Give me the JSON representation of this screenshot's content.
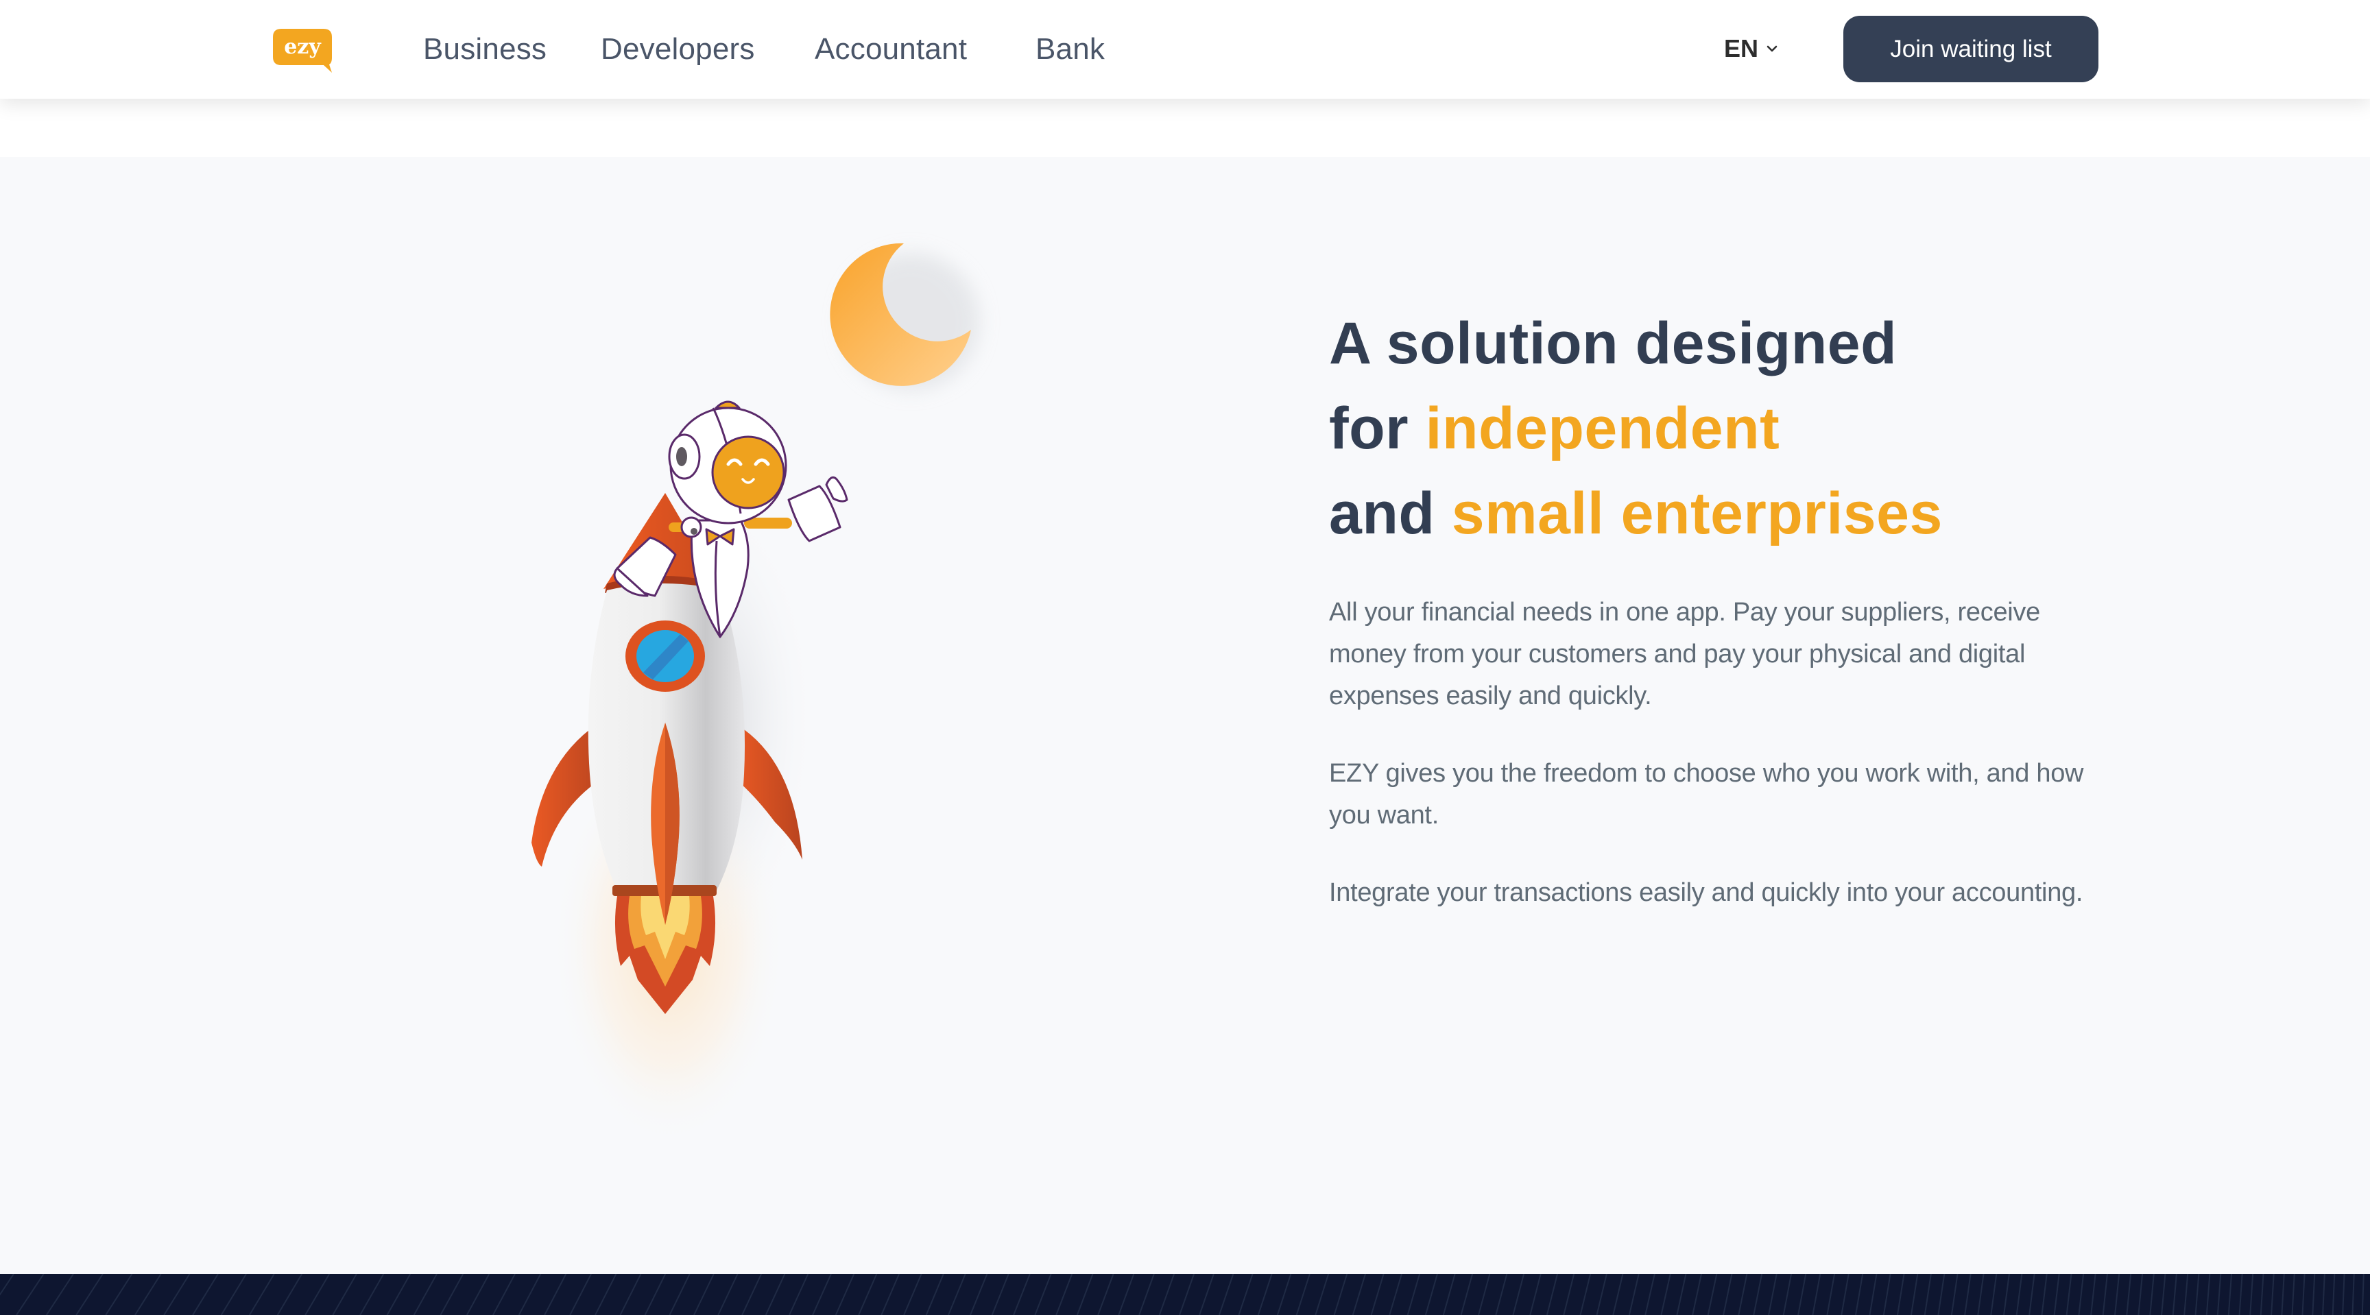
{
  "header": {
    "logo_text": "ezy",
    "logo_alt": "ezy logo",
    "nav": [
      {
        "label": "Business"
      },
      {
        "label": "Developers"
      },
      {
        "label": "Accountant"
      },
      {
        "label": "Bank"
      }
    ],
    "language": {
      "selected": "EN"
    },
    "cta_label": "Join waiting list"
  },
  "hero": {
    "headline": {
      "line1": "A solution designed",
      "line2_prefix": "for ",
      "line2_accent": "independent",
      "line3_prefix": "and ",
      "line3_accent": "small enterprises"
    },
    "paragraphs": [
      "All your financial needs in one app. Pay your suppliers, receive money from your customers and pay your physical and digital expenses easily and quickly.",
      "EZY gives you the freedom to choose who you work with, and how you want.",
      "Integrate your transactions easily and quickly into your accounting."
    ],
    "illustration": {
      "description": "Astronaut riding a rocket toward a crescent moon",
      "icons": [
        "moon-icon",
        "astronaut-icon",
        "rocket-icon"
      ]
    }
  },
  "colors": {
    "brand_orange": "#F3A620",
    "heading_dark": "#323E52",
    "nav_text": "#4A5568",
    "body_text": "#5F6B76",
    "cta_bg": "#344055",
    "hero_bg": "#F8F9FB",
    "footer_bg": "#0E1630"
  }
}
